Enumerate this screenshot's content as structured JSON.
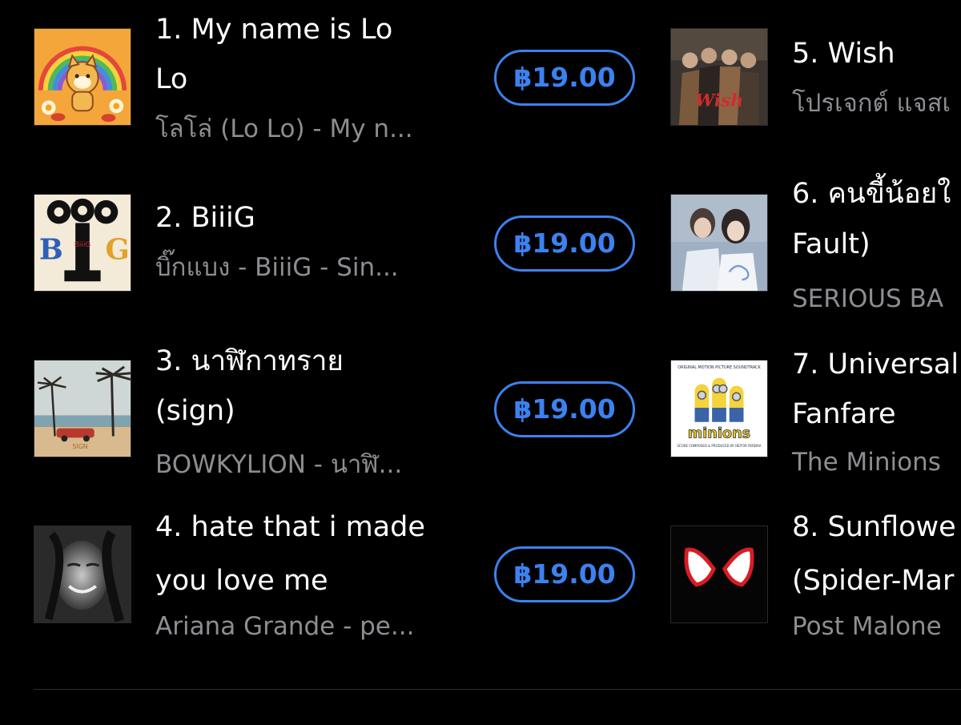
{
  "left_column": [
    {
      "art_icon": "album-art-lolo",
      "title_lines": [
        "1. My name is Lo",
        "Lo"
      ],
      "subtitle": "โลโล่ (Lo Lo) - My n...",
      "price": "฿19.00"
    },
    {
      "art_icon": "album-art-biiig",
      "title_lines": [
        "2. BiiiG"
      ],
      "subtitle": "บิ๊กแบง - BiiiG - Sin...",
      "price": "฿19.00"
    },
    {
      "art_icon": "album-art-sign",
      "title_lines": [
        "3. นาฬิกาทราย",
        "(sign)"
      ],
      "subtitle": "BOWKYLION - นาฬิ...",
      "price": "฿19.00"
    },
    {
      "art_icon": "album-art-ariana",
      "title_lines": [
        "4. hate that i made",
        "you love me"
      ],
      "subtitle": "Ariana Grande - pe...",
      "price": "฿19.00"
    }
  ],
  "right_column": [
    {
      "art_icon": "album-art-wish",
      "title_lines": [
        "5. Wish"
      ],
      "subtitle": "โปรเจกต์ แจสเ"
    },
    {
      "art_icon": "album-art-mysally",
      "title_lines": [
        "6. คนขี้น้อยใ",
        "Fault)"
      ],
      "subtitle": "SERIOUS BA"
    },
    {
      "art_icon": "album-art-minions",
      "title_lines": [
        "7. Universal",
        "Fanfare"
      ],
      "subtitle": "The Minions"
    },
    {
      "art_icon": "album-art-spiderman",
      "title_lines": [
        "8. Sunflowe",
        "(Spider-Mar"
      ],
      "subtitle": "Post Malone"
    }
  ],
  "art_text": {
    "biiig_word": "BiiiG",
    "sign_word": "SIGN",
    "minions_header": "ORIGINAL MOTION PICTURE SOUNDTRACK",
    "minions_word": "minions",
    "minions_credit": "SCORE COMPOSED & PRODUCED BY HEITOR PEREIRA",
    "wish_word": "Wish"
  },
  "colors": {
    "background": "#000000",
    "title": "#ffffff",
    "subtitle": "#8d8d92",
    "accent": "#3b82f0"
  }
}
